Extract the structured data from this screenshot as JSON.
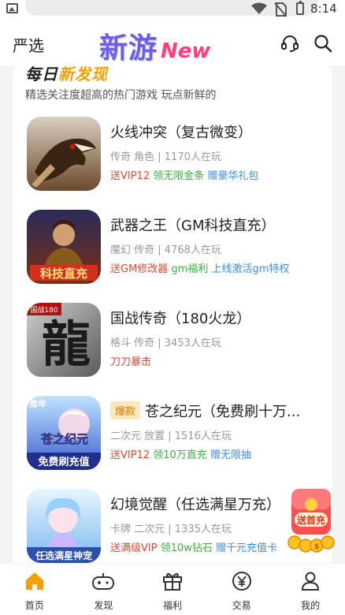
{
  "status_bar": {
    "time": "8:14"
  },
  "header": {
    "left_label": "严选",
    "logo_main": "新游",
    "logo_new": "New"
  },
  "section": {
    "title_a": "每日",
    "title_b": "新发现",
    "subtitle": "精选关注度超高的热门游戏 玩点新鲜的"
  },
  "games": [
    {
      "name": "火线冲突（复古微变）",
      "tag": "",
      "meta": "传奇 角色 | 1170人在玩",
      "benefits": [
        {
          "text": "送VIP12",
          "color": "red"
        },
        {
          "text": "领无限金条",
          "color": "green"
        },
        {
          "text": "赠豪华礼包",
          "color": "blue"
        }
      ]
    },
    {
      "name": "武器之王（GM科技直充）",
      "tag": "",
      "meta": "魔幻 传奇 | 4768人在玩",
      "icon_text": "科技直充",
      "benefits": [
        {
          "text": "送GM修改器",
          "color": "red"
        },
        {
          "text": "gm福利",
          "color": "green"
        },
        {
          "text": "上线激活gm特权",
          "color": "blue"
        }
      ]
    },
    {
      "name": "国战传奇（180火龙）",
      "tag": "",
      "meta": "格斗 传奇 | 3453人在玩",
      "icon_text": "龍",
      "icon_corner": "国战180",
      "benefits": [
        {
          "text": "刀刀暴击",
          "color": "red"
        }
      ]
    },
    {
      "name": "苍之纪元（免费刷十万...",
      "tag": "爆款",
      "meta": "二次元 放置 | 1516人在玩",
      "icon_text": "苍之纪元",
      "icon_sub": "免费刷充值",
      "icon_corner": "周年",
      "benefits": [
        {
          "text": "送VIP12",
          "color": "red"
        },
        {
          "text": "领10万直充",
          "color": "green"
        },
        {
          "text": "赠无限抽",
          "color": "blue"
        }
      ]
    },
    {
      "name": "幻境觉醒（任选满星万充）",
      "tag": "",
      "meta": "卡牌 二次元 | 1335人在玩",
      "icon_text": "任选满星神宠",
      "benefits": [
        {
          "text": "送满级VIP",
          "color": "red"
        },
        {
          "text": "领10w钻石",
          "color": "green"
        },
        {
          "text": "赠千元充值卡",
          "color": "blue"
        }
      ]
    }
  ],
  "float_badge": {
    "label": "送首充"
  },
  "tabs": [
    {
      "label": "首页",
      "icon": "home-icon",
      "active": true
    },
    {
      "label": "发现",
      "icon": "gamepad-icon",
      "active": false
    },
    {
      "label": "福利",
      "icon": "gift-icon",
      "active": false
    },
    {
      "label": "交易",
      "icon": "yen-icon",
      "active": false
    },
    {
      "label": "我的",
      "icon": "user-icon",
      "active": false
    }
  ],
  "colors": {
    "accent": "#f5a000",
    "red": "#f0452c",
    "green": "#3cb23c",
    "blue": "#3b8de8",
    "logo": "#6b5ee8"
  }
}
